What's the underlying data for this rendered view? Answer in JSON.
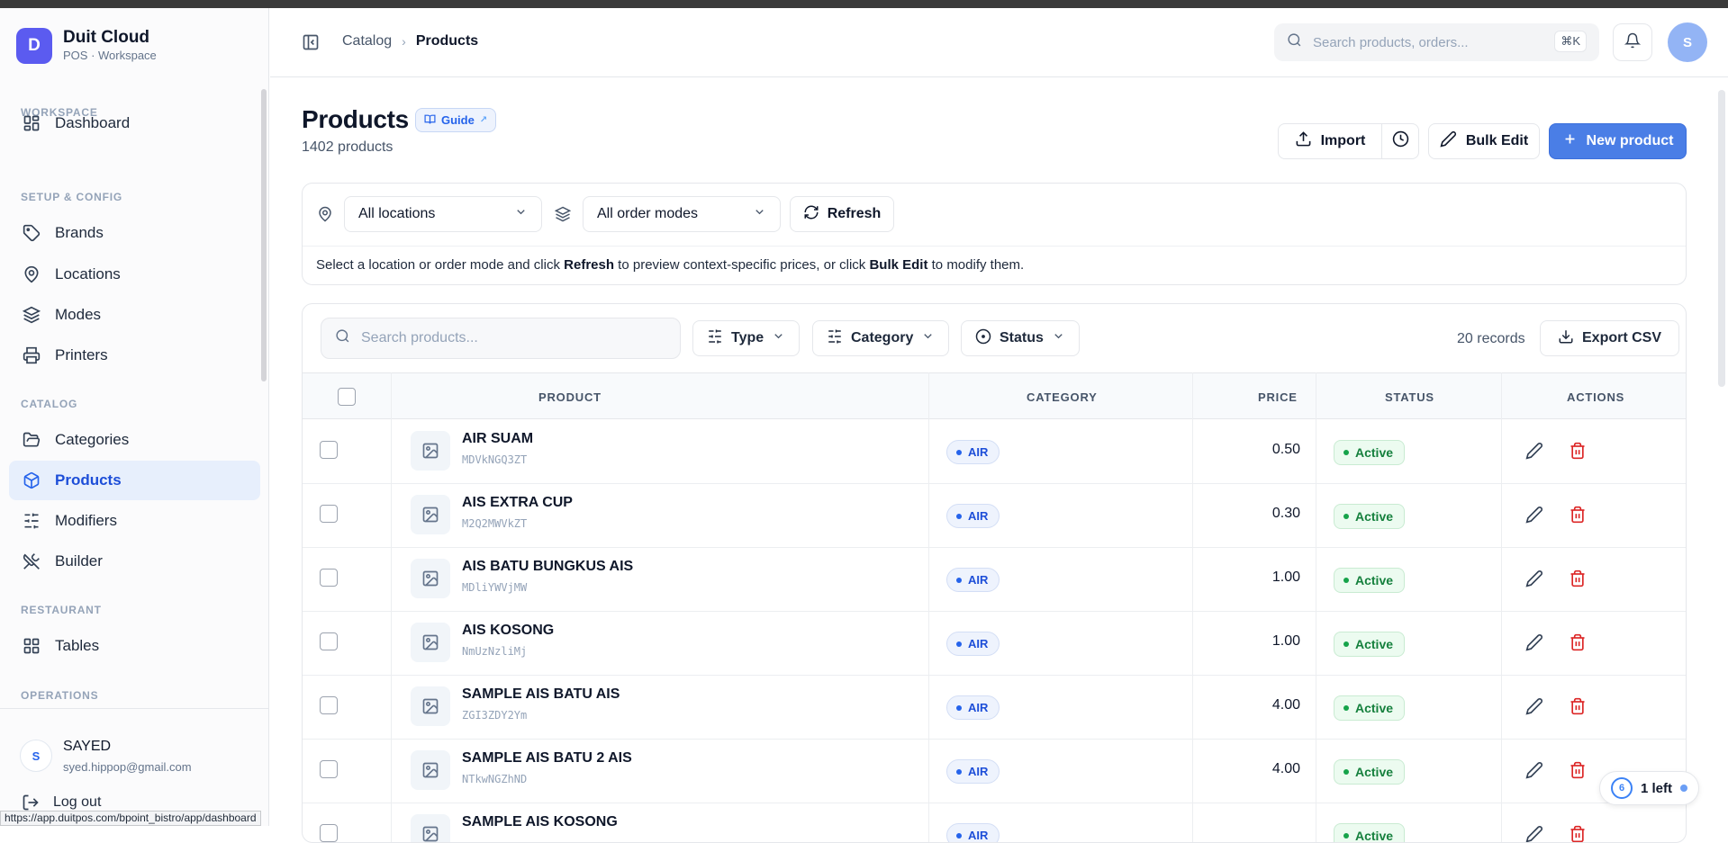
{
  "browser": {
    "status_url": "https://app.duitpos.com/bpoint_bistro/app/dashboard"
  },
  "brand": {
    "initial": "D",
    "name": "Duit Cloud",
    "subtitle": "POS · Workspace"
  },
  "sidebar": {
    "sections": [
      {
        "label": "WORKSPACE",
        "items": [
          {
            "label": "Dashboard",
            "icon": "dashboard-icon"
          }
        ]
      },
      {
        "label": "SETUP & CONFIG",
        "items": [
          {
            "label": "Brands",
            "icon": "tag-icon"
          },
          {
            "label": "Locations",
            "icon": "map-pin-icon"
          },
          {
            "label": "Modes",
            "icon": "layers-icon"
          },
          {
            "label": "Printers",
            "icon": "printer-icon"
          }
        ]
      },
      {
        "label": "CATALOG",
        "items": [
          {
            "label": "Categories",
            "icon": "folder-icon"
          },
          {
            "label": "Products",
            "icon": "box-icon",
            "active": true
          },
          {
            "label": "Modifiers",
            "icon": "sliders-icon"
          },
          {
            "label": "Builder",
            "icon": "utensils-icon"
          }
        ]
      },
      {
        "label": "RESTAURANT",
        "items": [
          {
            "label": "Tables",
            "icon": "grid-icon"
          }
        ]
      },
      {
        "label": "OPERATIONS",
        "items": []
      }
    ],
    "user": {
      "initial": "S",
      "name": "SAYED",
      "email": "syed.hippop@gmail.com"
    },
    "logout_label": "Log out"
  },
  "header": {
    "breadcrumb": [
      "Catalog",
      "Products"
    ],
    "search_placeholder": "Search products, orders...",
    "shortcut": "⌘K",
    "avatar_initial": "S"
  },
  "page": {
    "title": "Products",
    "guide_label": "Guide",
    "count_text": "1402 products",
    "import_label": "Import",
    "bulk_edit_label": "Bulk Edit",
    "new_product_label": "New product"
  },
  "filters": {
    "location": "All locations",
    "order_mode": "All order modes",
    "refresh_label": "Refresh",
    "hint_pre": "Select a location or order mode and click ",
    "hint_b1": "Refresh",
    "hint_mid": " to preview context-specific prices, or click ",
    "hint_b2": "Bulk Edit",
    "hint_post": " to modify them."
  },
  "table": {
    "search_placeholder": "Search products...",
    "type_label": "Type",
    "category_label": "Category",
    "status_label": "Status",
    "records_text": "20 records",
    "export_label": "Export CSV",
    "columns": {
      "product": "PRODUCT",
      "category": "CATEGORY",
      "price": "PRICE",
      "status": "STATUS",
      "actions": "ACTIONS"
    },
    "rows": [
      {
        "name": "AIR SUAM",
        "sku": "MDVkNGQ3ZT",
        "category": "AIR",
        "price": "0.50",
        "status": "Active"
      },
      {
        "name": "AIS EXTRA CUP",
        "sku": "M2Q2MWVkZT",
        "category": "AIR",
        "price": "0.30",
        "status": "Active"
      },
      {
        "name": "AIS BATU BUNGKUS AIS",
        "sku": "MDliYWVjMW",
        "category": "AIR",
        "price": "1.00",
        "status": "Active"
      },
      {
        "name": "AIS KOSONG",
        "sku": "NmUzNzliMj",
        "category": "AIR",
        "price": "1.00",
        "status": "Active"
      },
      {
        "name": "SAMPLE AIS BATU AIS",
        "sku": "ZGI3ZDY2Ym",
        "category": "AIR",
        "price": "4.00",
        "status": "Active"
      },
      {
        "name": "SAMPLE AIS BATU 2 AIS",
        "sku": "NTkwNGZhND",
        "category": "AIR",
        "price": "4.00",
        "status": "Active"
      },
      {
        "name": "SAMPLE AIS KOSONG",
        "sku": "",
        "category": "AIR",
        "price": "",
        "status": "Active"
      }
    ]
  },
  "onboarding": {
    "count": "6",
    "label": "1 left"
  },
  "colors": {
    "primary": "#4a7ee6",
    "brand": "#5b5bf0",
    "active_nav_bg": "#e7effc",
    "success": "#15803d",
    "danger": "#dc2626"
  }
}
